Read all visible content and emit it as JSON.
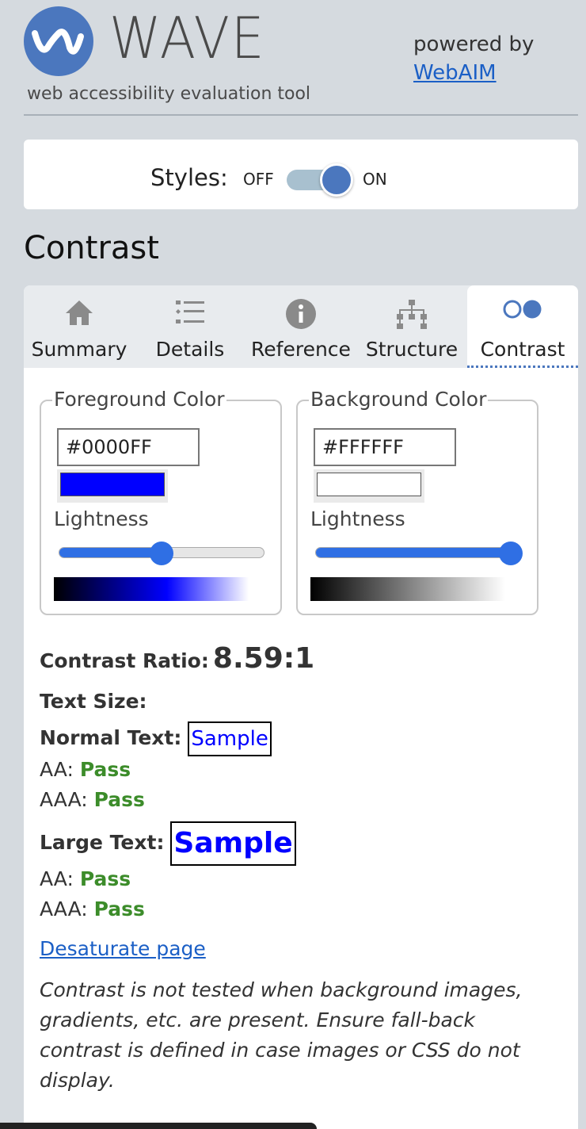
{
  "header": {
    "app_name": "WAVE",
    "tagline": "web accessibility evaluation tool",
    "powered_by": "powered by",
    "powered_link": "WebAIM"
  },
  "styles_toggle": {
    "label": "Styles:",
    "off_label": "OFF",
    "on_label": "ON",
    "state": "on"
  },
  "section_title": "Contrast",
  "tabs": [
    {
      "label": "Summary",
      "icon": "home-icon"
    },
    {
      "label": "Details",
      "icon": "list-icon"
    },
    {
      "label": "Reference",
      "icon": "info-icon"
    },
    {
      "label": "Structure",
      "icon": "structure-icon"
    },
    {
      "label": "Contrast",
      "icon": "contrast-icon",
      "active": true
    }
  ],
  "foreground": {
    "legend": "Foreground Color",
    "hex": "#0000FF",
    "swatch_color": "#0000ff",
    "lightness_label": "Lightness",
    "lightness_value": 0.5
  },
  "background": {
    "legend": "Background Color",
    "hex": "#FFFFFF",
    "swatch_color": "#ffffff",
    "lightness_label": "Lightness",
    "lightness_value": 1.0
  },
  "results": {
    "ratio_label": "Contrast Ratio:",
    "ratio_value": "8.59:1",
    "text_size_label": "Text Size:",
    "normal_label": "Normal Text:",
    "normal_sample": "Sample",
    "normal_aa_label": "AA:",
    "normal_aa": "Pass",
    "normal_aaa_label": "AAA:",
    "normal_aaa": "Pass",
    "large_label": "Large Text:",
    "large_sample": "Sample",
    "large_aa_label": "AA:",
    "large_aa": "Pass",
    "large_aaa_label": "AAA:",
    "large_aaa": "Pass",
    "desaturate_link": "Desaturate page",
    "note": "Contrast is not tested when background images, gradients, etc. are present. Ensure fall-back contrast is defined in case images or CSS do not display."
  },
  "colors": {
    "accent": "#4b77be",
    "pass": "#3c8c2a",
    "link": "#1b5fc6",
    "slider": "#2f6fe4"
  }
}
